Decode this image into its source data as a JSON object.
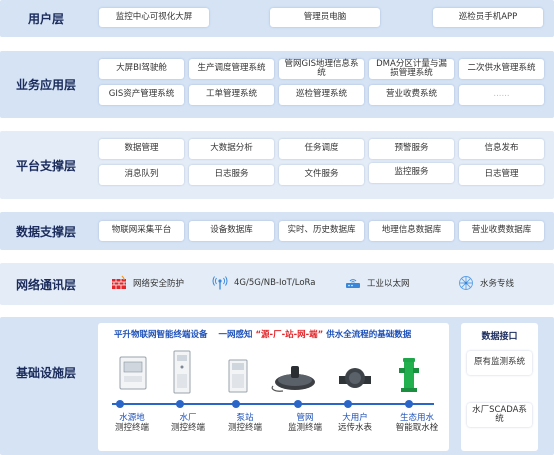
{
  "layers": {
    "user": {
      "title": "用户层",
      "items": [
        "监控中心可视化大屏",
        "管理员电脑",
        "巡检员手机APP"
      ]
    },
    "business": {
      "title": "业务应用层",
      "row1": [
        "大屏BI驾驶舱",
        "生产调度管理系统",
        "管网GIS地理信息系统",
        "DMA分区计量与漏损管理系统",
        "二次供水管理系统"
      ],
      "row2": [
        "GIS资产管理系统",
        "工单管理系统",
        "巡检管理系统",
        "营业收费系统",
        "......"
      ]
    },
    "platform": {
      "title": "平台支撑层",
      "row1": [
        "数据管理",
        "大数据分析",
        "任务调度",
        "预警服务",
        "信息发布"
      ],
      "row2": [
        "消息队列",
        "日志服务",
        "文件服务",
        "监控服务",
        "日志管理"
      ]
    },
    "data": {
      "title": "数据支撑层",
      "items": [
        "物联网采集平台",
        "设备数据库",
        "实时、历史数据库",
        "地理信息数据库",
        "营业收费数据库"
      ]
    },
    "network": {
      "title": "网络通讯层",
      "items": [
        {
          "label": "网络安全防护",
          "icon": "firewall-icon"
        },
        {
          "label": "4G/5G/NB-IoT/LoRa",
          "icon": "wireless-signal-icon"
        },
        {
          "label": "工业以太网",
          "icon": "router-icon"
        },
        {
          "label": "水务专线",
          "icon": "network-star-icon"
        }
      ]
    },
    "infra": {
      "title": "基础设施层",
      "headline_a": "平升物联网智能终端设备",
      "headline_b": "一网感知",
      "headline_c": "“源-厂-站-网-端”",
      "headline_d": "供水全流程的基础数据",
      "devices": [
        {
          "l1": "水源地",
          "l2": "测控终端",
          "icon": "rtu-cabinet-icon"
        },
        {
          "l1": "水厂",
          "l2": "测控终端",
          "icon": "control-cabinet-icon"
        },
        {
          "l1": "泵站",
          "l2": "测控终端",
          "icon": "pump-cabinet-icon"
        },
        {
          "l1": "管网",
          "l2": "监测终端",
          "icon": "manhole-monitor-icon"
        },
        {
          "l1": "大用户",
          "l2": "远传水表",
          "icon": "water-meter-icon"
        },
        {
          "l1": "生态用水",
          "l2": "智能取水栓",
          "icon": "hydrant-icon"
        }
      ],
      "interface": {
        "title": "数据接口",
        "items": [
          "原有监测系统",
          "水厂SCADA系统"
        ]
      }
    }
  },
  "colors": {
    "layer_bg_a": "#d5e3f5",
    "layer_bg_b": "#e4edf7",
    "title": "#1a2b5c",
    "blue_text": "#1f52b8",
    "accent_red": "#e2262a",
    "accent_green": "#1fa64a"
  }
}
